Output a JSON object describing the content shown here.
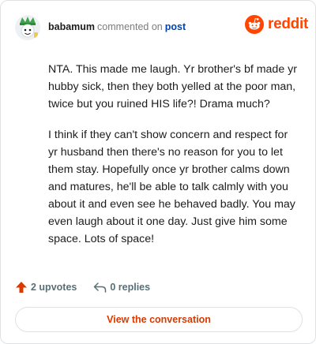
{
  "comment": {
    "username": "babamum",
    "commented_text": "commented on",
    "post_link": "post",
    "paragraphs": [
      "NTA. This made me laugh. Yr brother's bf made yr hubby sick, then they both yelled at the poor man, twice but you ruined HIS life?! Drama much?",
      "I think if they can't show concern and respect for yr husband then there's no reason for you to let them stay. Hopefully once yr brother calms down and matures, he'll be able to talk calmly with you about it and even see he behaved badly. You may even laugh about it one day. Just give him some space. Lots of space!"
    ]
  },
  "brand": {
    "logo_text": "reddit",
    "accent": "#ff4500"
  },
  "footer": {
    "upvotes": "2 upvotes",
    "replies": "0 replies"
  },
  "cta": {
    "label": "View the conversation",
    "color": "#d93a00"
  },
  "icons": [
    "avatar",
    "reddit-logo-icon",
    "upvote-icon",
    "reply-icon"
  ]
}
